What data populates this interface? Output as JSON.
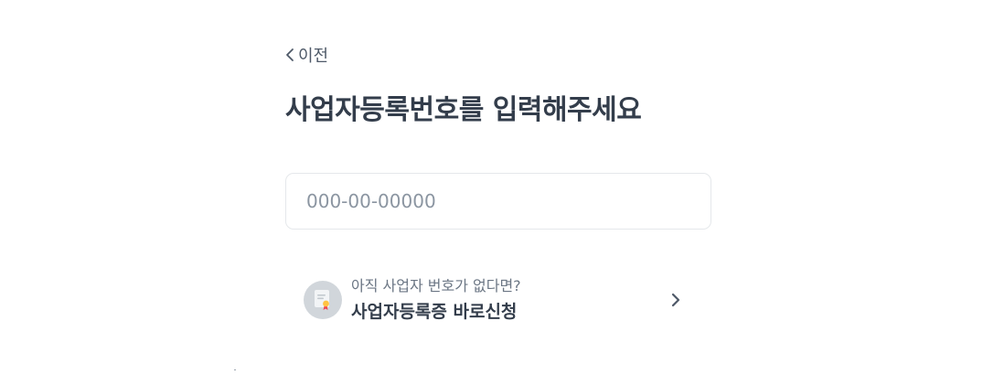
{
  "nav": {
    "back_label": "이전"
  },
  "page": {
    "title": "사업자등록번호를 입력해주세요"
  },
  "business_number": {
    "placeholder": "000-00-00000",
    "value": ""
  },
  "promo": {
    "subtitle": "아직 사업자 번호가 없다면?",
    "title": "사업자등록증 바로신청"
  },
  "icons": {
    "back": "chevron-left-icon",
    "promo": "certificate-icon",
    "promo_arrow": "chevron-right-icon"
  },
  "colors": {
    "text_primary": "#333d4b",
    "text_secondary": "#6b7684",
    "placeholder": "#8b95a1",
    "border": "#e5e8eb",
    "icon_bg": "#d1d6db",
    "ribbon": "#f04452"
  }
}
